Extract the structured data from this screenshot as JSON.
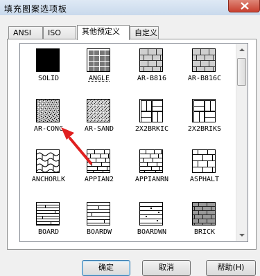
{
  "window": {
    "title": "填充图案选项板"
  },
  "tabs": [
    {
      "label": "ANSI",
      "active": false
    },
    {
      "label": "ISO",
      "active": false
    },
    {
      "label": "其他预定义",
      "active": true
    },
    {
      "label": "自定义",
      "active": false
    }
  ],
  "patterns": [
    {
      "label": "SOLID",
      "icon": "solid-swatch"
    },
    {
      "label": "ANGLE",
      "icon": "angle-swatch",
      "selected_style": "dotted-outline"
    },
    {
      "label": "AR-B816",
      "icon": "brick-swatch"
    },
    {
      "label": "AR-B816C",
      "icon": "brick-swatch"
    },
    {
      "label": "AR-CONC",
      "icon": "concrete-swatch"
    },
    {
      "label": "AR-SAND",
      "icon": "sand-swatch"
    },
    {
      "label": "2X2BRKIC",
      "icon": "parquet-swatch"
    },
    {
      "label": "2X2BRIKS",
      "icon": "parquet-swatch"
    },
    {
      "label": "ANCHORLK",
      "icon": "anchorlock-swatch"
    },
    {
      "label": "APPIAN2",
      "icon": "brick-swatch"
    },
    {
      "label": "APPIANRN",
      "icon": "brick-swatch"
    },
    {
      "label": "ASPHALT",
      "icon": "asphalt-swatch"
    },
    {
      "label": "BOARD",
      "icon": "board-swatch"
    },
    {
      "label": "BOARDW",
      "icon": "board-swatch"
    },
    {
      "label": "BOARDWN",
      "icon": "board-swatch"
    },
    {
      "label": "BRICK",
      "icon": "brick-swatch"
    }
  ],
  "buttons": {
    "ok": "确定",
    "cancel": "取消",
    "help": "帮助(H)"
  },
  "annotation": {
    "icon": "red-arrow-icon",
    "color": "#e02020"
  }
}
